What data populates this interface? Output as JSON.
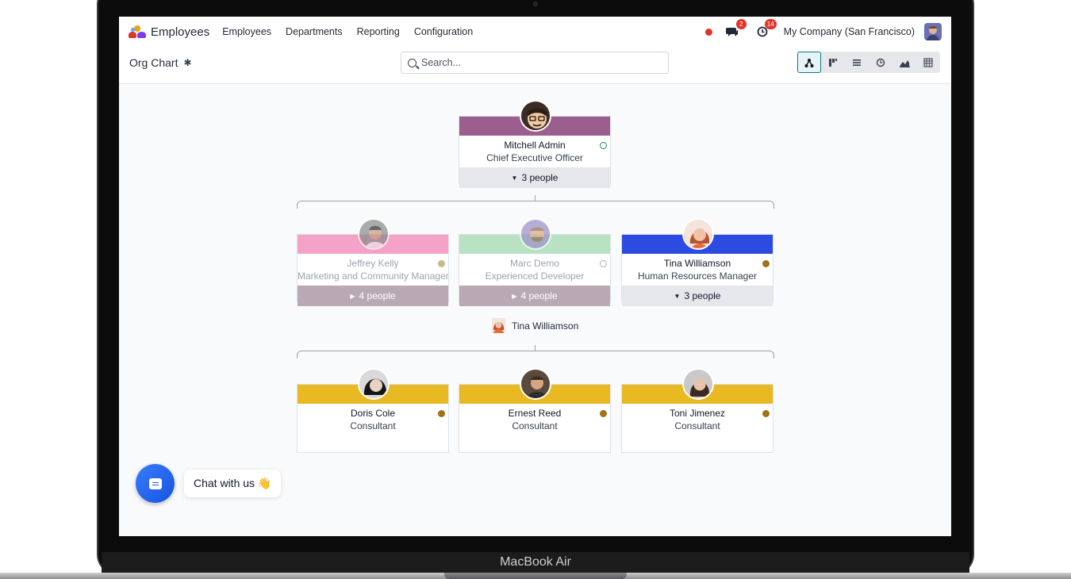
{
  "device": {
    "label": "MacBook Air"
  },
  "navbar": {
    "app_name": "Employees",
    "menu": [
      "Employees",
      "Departments",
      "Reporting",
      "Configuration"
    ],
    "messages_badge": "2",
    "activities_badge": "14",
    "company": "My Company (San Francisco)"
  },
  "control": {
    "title": "Org Chart",
    "search_placeholder": "Search...",
    "views": [
      "hierarchy-icon",
      "kanban-icon",
      "list-icon",
      "activity-icon",
      "graph-icon",
      "pivot-icon"
    ]
  },
  "org": {
    "root": {
      "name": "Mitchell Admin",
      "job": "Chief Executive Officer",
      "people": "3 people",
      "color": "#9c5d8f",
      "presence": "#1e8f3e"
    },
    "level1": [
      {
        "name": "Jeffrey Kelly",
        "job": "Marketing and Community Manager",
        "people": "4 people",
        "color": "#f5a2c8",
        "presence": "#c8b88a",
        "dimmed": true
      },
      {
        "name": "Marc Demo",
        "job": "Experienced Developer",
        "people": "4 people",
        "color": "#b8e2c1",
        "presence": "#b0b0b0",
        "dimmed": true
      },
      {
        "name": "Tina Williamson",
        "job": "Human Resources Manager",
        "people": "3 people",
        "color": "#2c4be0",
        "presence": "#a0721a",
        "dimmed": false
      }
    ],
    "subtree_manager": "Tina Williamson",
    "level2": [
      {
        "name": "Doris Cole",
        "job": "Consultant",
        "color": "#e8b923",
        "presence": "#a0721a"
      },
      {
        "name": "Ernest Reed",
        "job": "Consultant",
        "color": "#e8b923",
        "presence": "#a0721a"
      },
      {
        "name": "Toni Jimenez",
        "job": "Consultant",
        "color": "#e8b923",
        "presence": "#a0721a"
      }
    ]
  },
  "chat": {
    "label": "Chat with us 👋"
  }
}
